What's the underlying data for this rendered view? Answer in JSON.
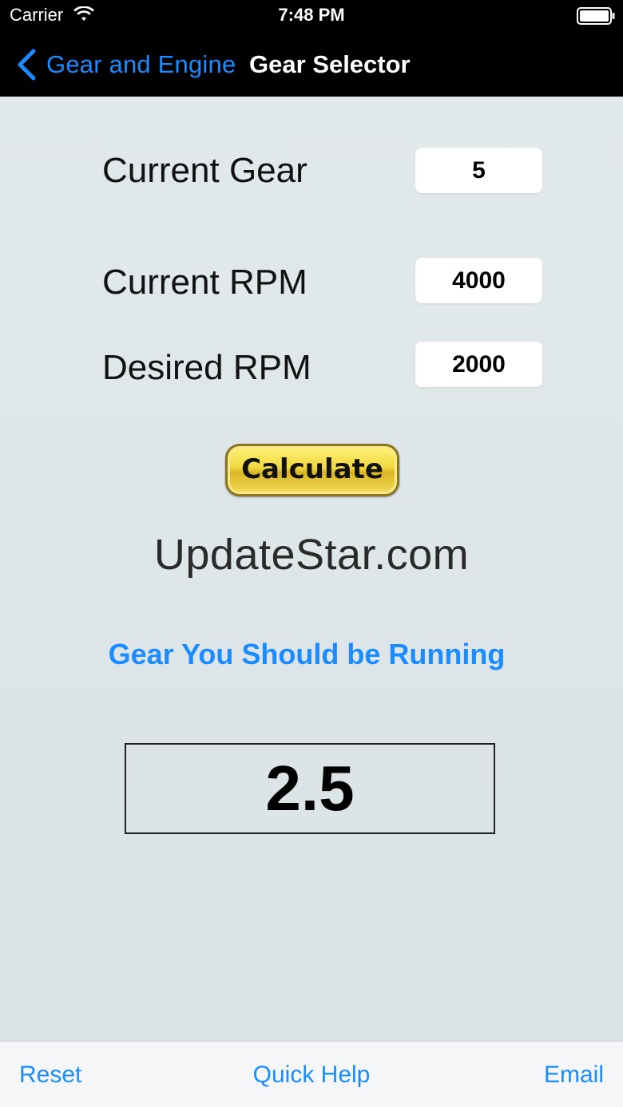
{
  "status_bar": {
    "carrier": "Carrier",
    "time": "7:48 PM",
    "wifi_icon": "wifi-icon",
    "battery_icon": "battery-icon"
  },
  "nav": {
    "back_label": "Gear and Engine",
    "title": "Gear Selector"
  },
  "form": {
    "current_gear_label": "Current Gear",
    "current_gear_value": "5",
    "current_rpm_label": "Current RPM",
    "current_rpm_value": "4000",
    "desired_rpm_label": "Desired RPM",
    "desired_rpm_value": "2000",
    "calculate_label": "Calculate"
  },
  "brand": "UpdateStar.com",
  "result": {
    "heading": "Gear You Should be Running",
    "value": "2.5"
  },
  "toolbar": {
    "reset": "Reset",
    "help": "Quick Help",
    "email": "Email"
  },
  "colors": {
    "accent": "#1a8cff",
    "header_bg": "#000000",
    "content_bg": "#dde5e8",
    "button_gold": "#f2d840"
  }
}
